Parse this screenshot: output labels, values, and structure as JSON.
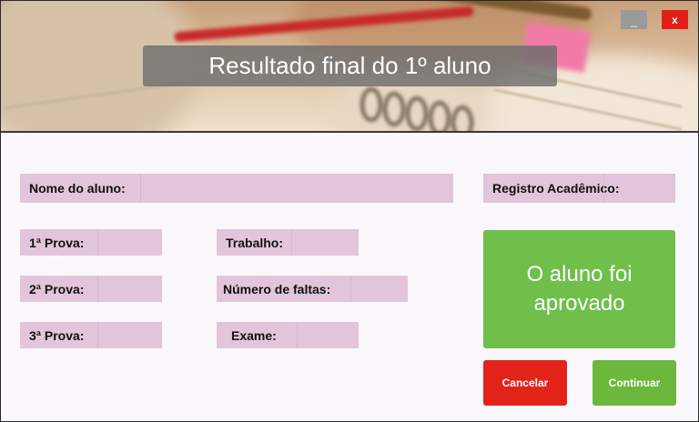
{
  "window": {
    "title": "Resultado final do 1º aluno",
    "minimize_label": "_",
    "close_label": "x"
  },
  "form": {
    "nome_label": "Nome do aluno:",
    "nome_value": "",
    "registro_label": "Registro Acadêmico:",
    "registro_value": "",
    "prova1_label": "1ª Prova:",
    "prova1_value": "",
    "prova2_label": "2ª Prova:",
    "prova2_value": "",
    "prova3_label": "3ª Prova:",
    "prova3_value": "",
    "trabalho_label": "Trabalho:",
    "trabalho_value": "",
    "faltas_label": "Número de faltas:",
    "faltas_value": "",
    "exame_label": "Exame:",
    "exame_value": ""
  },
  "result": {
    "text": "O aluno foi aprovado",
    "color": "#6fbf4a"
  },
  "buttons": {
    "cancel_label": "Cancelar",
    "cancel_color": "#e2231a",
    "continue_label": "Continuar",
    "continue_color": "#6cb83c"
  }
}
